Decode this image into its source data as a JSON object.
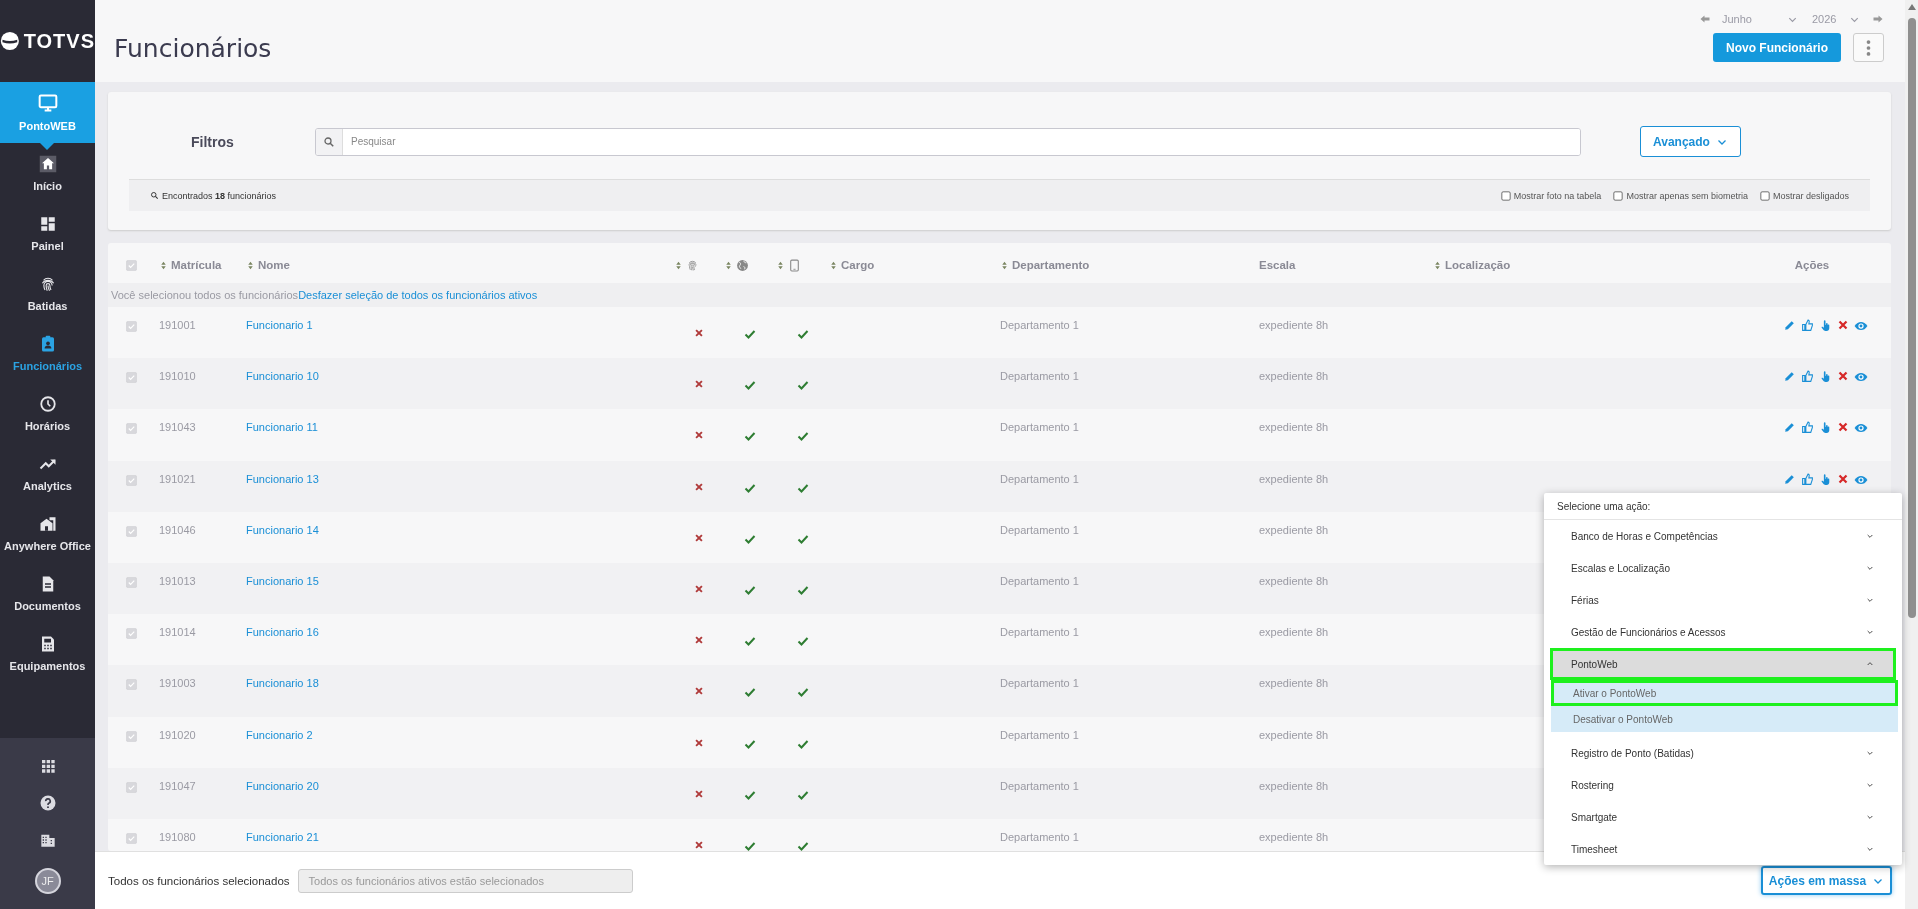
{
  "sidebar": {
    "logo": "TOTVS",
    "product": {
      "label": "PontoWEB",
      "selected": true
    },
    "items": [
      {
        "label": "Início",
        "selected": false
      },
      {
        "label": "Painel",
        "selected": false
      },
      {
        "label": "Batidas",
        "selected": false
      },
      {
        "label": "Funcionários",
        "selected": true
      },
      {
        "label": "Horários",
        "selected": false
      },
      {
        "label": "Analytics",
        "selected": false
      },
      {
        "label": "Anywhere Office",
        "selected": false
      },
      {
        "label": "Documentos",
        "selected": false
      },
      {
        "label": "Equipamentos",
        "selected": false
      }
    ],
    "avatar": "JF"
  },
  "header": {
    "title": "Funcionários",
    "month": "Junho",
    "year": "2026",
    "new_button": "Novo Funcionário"
  },
  "filters": {
    "label": "Filtros",
    "search_placeholder": "Pesquisar",
    "advanced_button": "Avançado",
    "found": "Encontrados **18** funcionários",
    "options": [
      {
        "label": "Mostrar foto na tabela",
        "checked": false
      },
      {
        "label": "Mostrar apenas sem biometria",
        "checked": false
      },
      {
        "label": "Mostrar desligados",
        "checked": false
      }
    ]
  },
  "table": {
    "select_all_checked": true,
    "columns": [
      {
        "kind": "text",
        "label": "Matrícula",
        "sortable": true
      },
      {
        "kind": "text",
        "label": "Nome",
        "sortable": true
      },
      {
        "kind": "fingerprint",
        "sortable": true
      },
      {
        "kind": "globe",
        "sortable": true
      },
      {
        "kind": "phone",
        "sortable": true
      },
      {
        "kind": "text",
        "label": "Cargo",
        "sortable": true
      },
      {
        "kind": "text",
        "label": "Departamento",
        "sortable": true
      },
      {
        "kind": "text",
        "label": "Escala",
        "sortable": false
      },
      {
        "kind": "text",
        "label": "Localização",
        "sortable": true
      },
      {
        "kind": "text",
        "label": "Ações",
        "sortable": false
      }
    ],
    "banner": {
      "text": "Você selecionou todos os funcionários",
      "link": "Desfazer seleção de todos os funcionários ativos"
    },
    "rows": [
      {
        "checked": true,
        "matricula": "191001",
        "nome": "Funcionario 1",
        "biometria": false,
        "web": true,
        "app": true,
        "departamento": "Departamento 1",
        "escala": "expediente 8h",
        "actions_visible": true
      },
      {
        "checked": true,
        "matricula": "191010",
        "nome": "Funcionario 10",
        "biometria": false,
        "web": true,
        "app": true,
        "departamento": "Departamento 1",
        "escala": "expediente 8h",
        "actions_visible": true
      },
      {
        "checked": true,
        "matricula": "191043",
        "nome": "Funcionario 11",
        "biometria": false,
        "web": true,
        "app": true,
        "departamento": "Departamento 1",
        "escala": "expediente 8h",
        "actions_visible": true
      },
      {
        "checked": true,
        "matricula": "191021",
        "nome": "Funcionario 13",
        "biometria": false,
        "web": true,
        "app": true,
        "departamento": "Departamento 1",
        "escala": "expediente 8h",
        "actions_visible": true
      },
      {
        "checked": true,
        "matricula": "191046",
        "nome": "Funcionario 14",
        "biometria": false,
        "web": true,
        "app": true,
        "departamento": "Departamento 1",
        "escala": "expediente 8h",
        "actions_visible": false
      },
      {
        "checked": true,
        "matricula": "191013",
        "nome": "Funcionario 15",
        "biometria": false,
        "web": true,
        "app": true,
        "departamento": "Departamento 1",
        "escala": "expediente 8h",
        "actions_visible": false
      },
      {
        "checked": true,
        "matricula": "191014",
        "nome": "Funcionario 16",
        "biometria": false,
        "web": true,
        "app": true,
        "departamento": "Departamento 1",
        "escala": "expediente 8h",
        "actions_visible": false
      },
      {
        "checked": true,
        "matricula": "191003",
        "nome": "Funcionario 18",
        "biometria": false,
        "web": true,
        "app": true,
        "departamento": "Departamento 1",
        "escala": "expediente 8h",
        "actions_visible": false
      },
      {
        "checked": true,
        "matricula": "191020",
        "nome": "Funcionario 2",
        "biometria": false,
        "web": true,
        "app": true,
        "departamento": "Departamento 1",
        "escala": "expediente 8h",
        "actions_visible": false
      },
      {
        "checked": true,
        "matricula": "191047",
        "nome": "Funcionario 20",
        "biometria": false,
        "web": true,
        "app": true,
        "departamento": "Departamento 1",
        "escala": "expediente 8h",
        "actions_visible": false
      },
      {
        "checked": true,
        "matricula": "191080",
        "nome": "Funcionario 21",
        "biometria": false,
        "web": true,
        "app": true,
        "departamento": "Departamento 1",
        "escala": "expediente 8h",
        "actions_visible": false
      }
    ]
  },
  "footer": {
    "label": "Todos os funcionários selecionados",
    "field_value": "Todos os funcionários ativos estão selecionados",
    "mass_button": "Ações em massa"
  },
  "menu": {
    "title": "Selecione uma ação:",
    "items": [
      {
        "kind": "group",
        "label": "Banco de Horas e Competências",
        "expanded": false,
        "highlighted": false
      },
      {
        "kind": "group",
        "label": "Escalas e Localização",
        "expanded": false,
        "highlighted": false
      },
      {
        "kind": "group",
        "label": "Férias",
        "expanded": false,
        "highlighted": false
      },
      {
        "kind": "group",
        "label": "Gestão de Funcionários e Acessos",
        "expanded": false,
        "highlighted": false
      },
      {
        "kind": "group",
        "label": "PontoWeb",
        "expanded": true,
        "highlighted": true
      },
      {
        "kind": "option",
        "label": "Ativar o PontoWeb",
        "highlighted": true
      },
      {
        "kind": "option",
        "label": "Desativar o PontoWeb",
        "highlighted": false
      },
      {
        "kind": "group",
        "label": "Registro de Ponto (Batidas)",
        "expanded": false,
        "highlighted": false
      },
      {
        "kind": "group",
        "label": "Rostering",
        "expanded": false,
        "highlighted": false
      },
      {
        "kind": "group",
        "label": "Smartgate",
        "expanded": false,
        "highlighted": false
      },
      {
        "kind": "group",
        "label": "Timesheet",
        "expanded": false,
        "highlighted": false
      }
    ]
  }
}
